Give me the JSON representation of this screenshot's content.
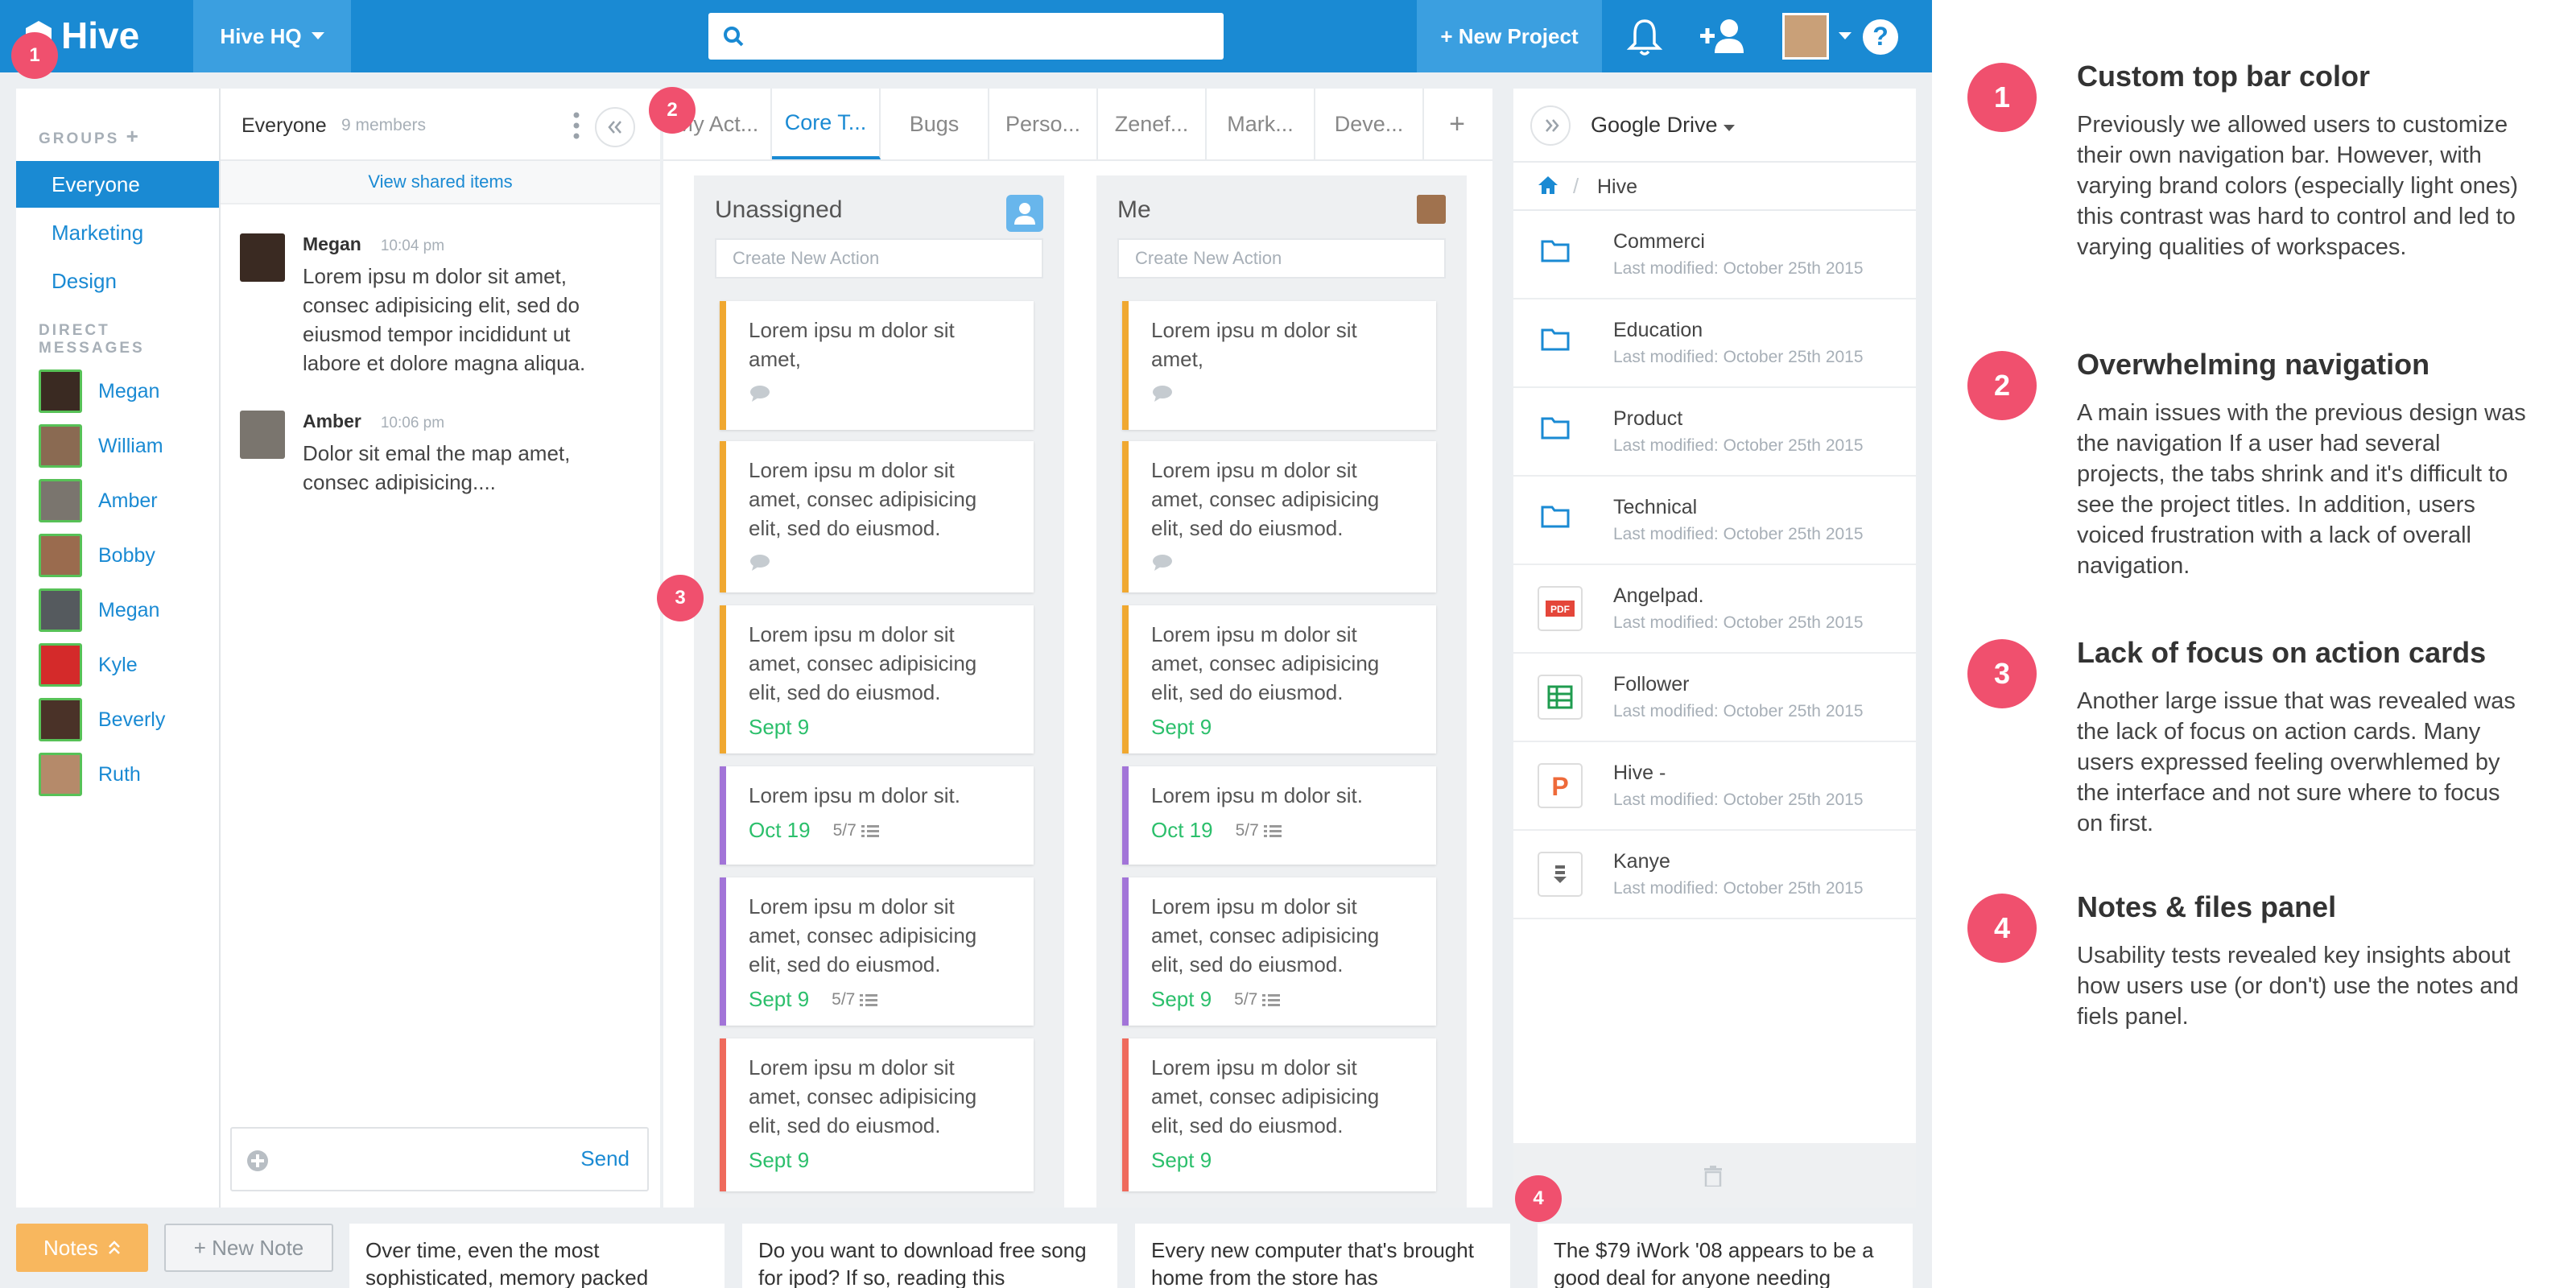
{
  "app": {
    "logo": "Hive",
    "workspace": "Hive HQ",
    "new_project": "+ New Project",
    "search_placeholder": ""
  },
  "groups": {
    "title": "GROUPS",
    "items": [
      {
        "label": "Everyone",
        "active": true
      },
      {
        "label": "Marketing",
        "active": false
      },
      {
        "label": "Design",
        "active": false
      }
    ],
    "dm_title": "DIRECT MESSAGES",
    "dms": [
      "Megan",
      "William",
      "Amber",
      "Bobby",
      "Megan",
      "Kyle",
      "Beverly",
      "Ruth"
    ]
  },
  "chat": {
    "channel": "Everyone",
    "members": "9 members",
    "view_shared": "View shared items",
    "messages": [
      {
        "name": "Megan",
        "time": "10:04 pm",
        "text": "Lorem ipsu m dolor sit amet, consec adipisicing elit, sed do eiusmod tempor incididunt ut labore et dolore magna aliqua."
      },
      {
        "name": "Amber",
        "time": "10:06 pm",
        "text": "Dolor sit emal the map amet, consec adipisicing...."
      }
    ],
    "send": "Send"
  },
  "tabs": [
    "My Act...",
    "Core T...",
    "Bugs",
    "Perso...",
    "Zenef...",
    "Mark...",
    "Deve..."
  ],
  "columns": [
    {
      "title": "Unassigned",
      "create": "Create New Action",
      "cards": [
        {
          "text": "Lorem ipsu m dolor sit amet,",
          "color": "#f0a830",
          "due": "",
          "subtasks": "",
          "comment": true
        },
        {
          "text": "Lorem ipsu m dolor sit amet, consec adipisicing elit, sed do eiusmod.",
          "color": "#f0a830",
          "due": "",
          "subtasks": "",
          "comment": true
        },
        {
          "text": "Lorem ipsu m dolor sit amet, consec adipisicing elit, sed do eiusmod.",
          "color": "#f0a830",
          "due": "Sept 9",
          "subtasks": "",
          "comment": false
        },
        {
          "text": "Lorem ipsu m dolor sit.",
          "color": "#a274d8",
          "due": "Oct 19",
          "subtasks": "5/7",
          "comment": false
        },
        {
          "text": "Lorem ipsu m dolor sit amet, consec adipisicing elit, sed do eiusmod.",
          "color": "#a274d8",
          "due": "Sept 9",
          "subtasks": "5/7",
          "comment": false
        },
        {
          "text": "Lorem ipsu m dolor sit amet, consec adipisicing elit, sed do eiusmod.",
          "color": "#ef6a5c",
          "due": "Sept 9",
          "subtasks": "",
          "comment": false
        }
      ]
    },
    {
      "title": "Me",
      "create": "Create New Action",
      "cards": [
        {
          "text": "Lorem ipsu m dolor sit amet,",
          "color": "#f0a830",
          "due": "",
          "subtasks": "",
          "comment": true
        },
        {
          "text": "Lorem ipsu m dolor sit amet, consec adipisicing elit, sed do eiusmod.",
          "color": "#f0a830",
          "due": "",
          "subtasks": "",
          "comment": true
        },
        {
          "text": "Lorem ipsu m dolor sit amet, consec adipisicing elit, sed do eiusmod.",
          "color": "#f0a830",
          "due": "Sept 9",
          "subtasks": "",
          "comment": false
        },
        {
          "text": "Lorem ipsu m dolor sit.",
          "color": "#a274d8",
          "due": "Oct 19",
          "subtasks": "5/7",
          "comment": false
        },
        {
          "text": "Lorem ipsu m dolor sit amet, consec adipisicing elit, sed do eiusmod.",
          "color": "#a274d8",
          "due": "Sept 9",
          "subtasks": "5/7",
          "comment": false
        },
        {
          "text": "Lorem ipsu m dolor sit amet, consec adipisicing elit, sed do eiusmod.",
          "color": "#ef6a5c",
          "due": "Sept 9",
          "subtasks": "",
          "comment": false
        }
      ]
    }
  ],
  "files": {
    "source": "Google Drive",
    "breadcrumb": "Hive",
    "items": [
      {
        "name": "Commerci",
        "modified": "Last modified: October 25th 2015",
        "icon": "folder-icon"
      },
      {
        "name": "Education",
        "modified": "Last modified: October 25th 2015",
        "icon": "folder-icon"
      },
      {
        "name": "Product",
        "modified": "Last modified: October 25th 2015",
        "icon": "folder-icon"
      },
      {
        "name": "Technical",
        "modified": "Last modified: October 25th 2015",
        "icon": "folder-icon"
      },
      {
        "name": "Angelpad.",
        "modified": "Last modified: October 25th 2015",
        "icon": "pdf-icon"
      },
      {
        "name": "Follower",
        "modified": "Last modified: October 25th 2015",
        "icon": "sheet-icon"
      },
      {
        "name": "Hive -",
        "modified": "Last modified: October 25th 2015",
        "icon": "slides-icon"
      },
      {
        "name": "Kanye",
        "modified": "Last modified: October 25th 2015",
        "icon": "doc-icon"
      }
    ]
  },
  "notes": {
    "button": "Notes",
    "new_note": "+ New Note",
    "items": [
      "Over time, even the most sophisticated, memory packed",
      "Do you want to download free song for ipod? If so, reading this",
      "Every new computer that's brought home from the store has",
      "The $79 iWork '08 appears to be a good deal for anyone needing"
    ]
  },
  "annotations": [
    {
      "num": "1",
      "title": "Custom top bar color",
      "text": "Previously we allowed users to customize their own navigation bar. However, with varying brand colors (especially light ones) this contrast was hard to control and led to varying qualities of workspaces."
    },
    {
      "num": "2",
      "title": "Overwhelming navigation",
      "text": "A main issues with the previous design was the navigation If a user had several projects, the tabs shrink and it's difficult to see the project titles. In addition, users voiced frustration with a lack of overall navigation."
    },
    {
      "num": "3",
      "title": "Lack of focus on action cards",
      "text": "Another large issue that was revealed was the lack of focus on action cards. Many users expressed feeling overwhlemed by the interface and not sure where to focus on first."
    },
    {
      "num": "4",
      "title": "Notes & files panel",
      "text": "Usability tests revealed key insights about how users use (or don't) use the notes and fiels panel."
    }
  ],
  "colors": {
    "brand": "#1a8ad3",
    "badge": "#f0506e",
    "due": "#2bbf6b",
    "notes": "#f8b75e"
  }
}
